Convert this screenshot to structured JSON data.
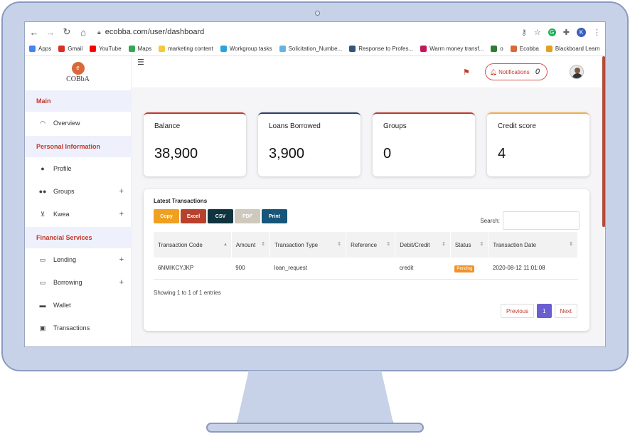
{
  "browser": {
    "url": "ecobba.com/user/dashboard",
    "bookmarks": [
      {
        "label": "Apps",
        "color": "#4285f4"
      },
      {
        "label": "Gmail",
        "color": "#d93025"
      },
      {
        "label": "YouTube",
        "color": "#ff0000"
      },
      {
        "label": "Maps",
        "color": "#34a853"
      },
      {
        "label": "marketing content",
        "color": "#f5c842"
      },
      {
        "label": "Workgroup tasks",
        "color": "#2aa5d9"
      },
      {
        "label": "Solicitation_Numbe...",
        "color": "#63b4e6"
      },
      {
        "label": "Response to Profes...",
        "color": "#34567a"
      },
      {
        "label": "Warm money transf...",
        "color": "#c2185b"
      },
      {
        "label": "o",
        "color": "#2e7d32"
      },
      {
        "label": "Ecobba",
        "color": "#d9683a"
      },
      {
        "label": "Blackboard Learn",
        "color": "#e0a020"
      }
    ],
    "profile_initial": "K"
  },
  "logo": {
    "letter": "e",
    "text": "COBbA"
  },
  "sidebar": {
    "section_main": "Main",
    "overview": "Overview",
    "section_personal": "Personal Information",
    "profile": "Profile",
    "groups": "Groups",
    "kwea": "Kwea",
    "section_financial": "Financial Services",
    "lending": "Lending",
    "borrowing": "Borrowing",
    "wallet": "Wallet",
    "transactions": "Transactions"
  },
  "topbar": {
    "notifications_label": "Notifications",
    "notifications_count": "0"
  },
  "cards": [
    {
      "title": "Balance",
      "value": "38,900"
    },
    {
      "title": "Loans Borrowed",
      "value": "3,900"
    },
    {
      "title": "Groups",
      "value": "0"
    },
    {
      "title": "Credit score",
      "value": "4"
    }
  ],
  "transactions": {
    "title": "Latest Transactions",
    "buttons": {
      "copy": "Copy",
      "excel": "Excel",
      "csv": "CSV",
      "pdf": "PDF",
      "print": "Print"
    },
    "search_label": "Search:",
    "columns": [
      "Transaction Code",
      "Amount",
      "Transaction Type",
      "Reference",
      "Debit/Credit",
      "Status",
      "Transaction Date"
    ],
    "rows": [
      {
        "code": "6NMIKCYJKP",
        "amount": "900",
        "type": "loan_request",
        "reference": "",
        "debit_credit": "credit",
        "status": "Pending",
        "date": "2020-08-12 11:01:08"
      }
    ],
    "showing": "Showing 1 to 1 of 1 entries",
    "pager": {
      "previous": "Previous",
      "current": "1",
      "next": "Next"
    }
  },
  "colors": {
    "accent": "#c0392b",
    "pending": "#f0932b",
    "active_page": "#6a5fd0"
  }
}
